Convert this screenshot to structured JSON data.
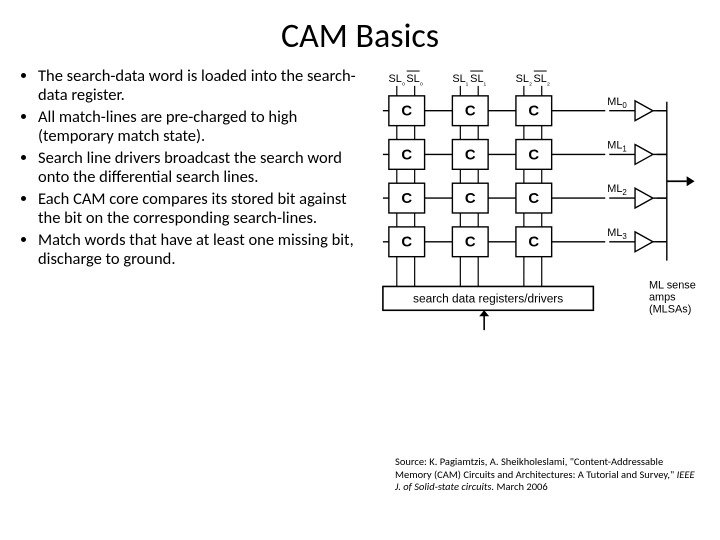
{
  "title": "CAM Basics",
  "bullets": [
    "The search-data word is loaded into the search-data register.",
    "All match-lines are pre-charged to high (temporary match state).",
    "Search line drivers broadcast the search word onto the differential search lines.",
    "Each CAM core compares its stored bit against the bit on the corresponding search-lines.",
    "Match words that have at least one missing bit, discharge to ground."
  ],
  "source": {
    "prefix": "Source: K. Pagiamtzis, A. Sheikholeslami, \"Content-Addressable Memory (CAM) Circuits and Architectures: A Tutorial and Survey,\" ",
    "journal": "IEEE J. of Solid-state circuits. ",
    "suffix": "March 2006"
  },
  "diagram": {
    "search_lines": [
      "SL₀",
      "S̄L₀",
      "SL₁",
      "S̄L₁",
      "SL₂",
      "S̄L₂"
    ],
    "match_lines": [
      "ML₀",
      "ML₁",
      "ML₂",
      "ML₃"
    ],
    "cell_label": "C",
    "register_box": "search data registers/drivers",
    "mlse_label": "ML sense\namps\n(MLSAs)",
    "rows": 4,
    "cols": 3
  }
}
